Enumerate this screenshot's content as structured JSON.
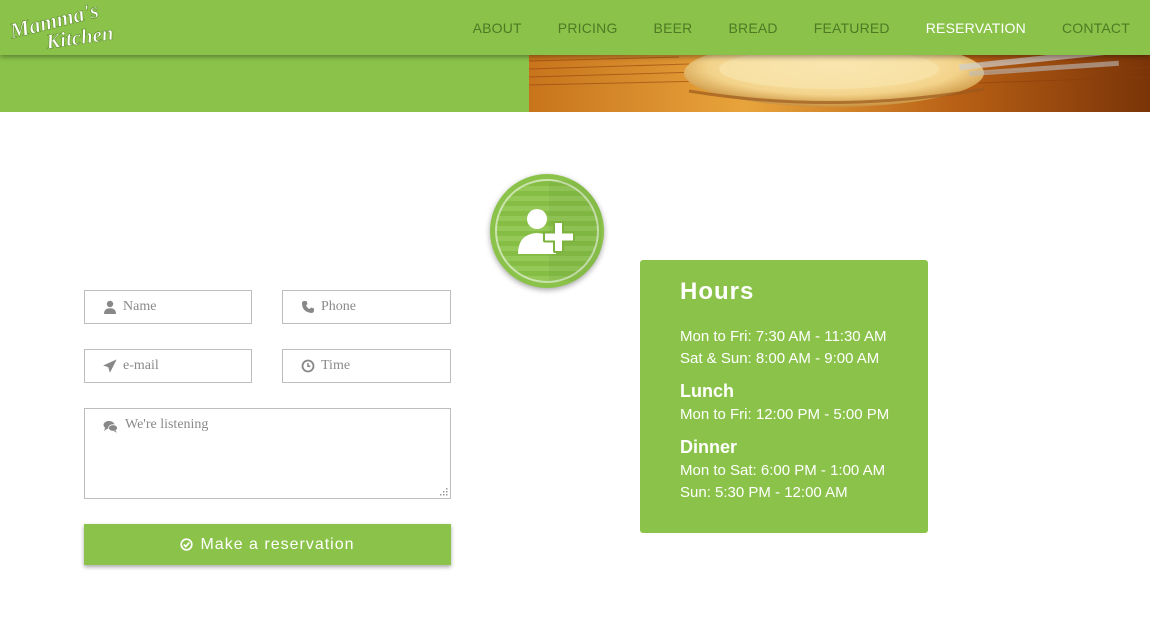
{
  "brand": {
    "logo_text_line1": "Mamma's",
    "logo_text_line2": "Kitchen"
  },
  "nav": {
    "items": [
      {
        "label": "ABOUT",
        "active": false
      },
      {
        "label": "PRICING",
        "active": false
      },
      {
        "label": "BEER",
        "active": false
      },
      {
        "label": "BREAD",
        "active": false
      },
      {
        "label": "FEATURED",
        "active": false
      },
      {
        "label": "RESERVATION",
        "active": true
      },
      {
        "label": "CONTACT",
        "active": false
      }
    ]
  },
  "badge": {
    "icon": "add-user-icon"
  },
  "form": {
    "name": {
      "placeholder": "Name",
      "value": "",
      "icon": "user-icon"
    },
    "phone": {
      "placeholder": "Phone",
      "value": "",
      "icon": "phone-icon"
    },
    "email": {
      "placeholder": "e-mail",
      "value": "",
      "icon": "paper-plane-icon"
    },
    "time": {
      "placeholder": "Time",
      "value": "",
      "icon": "clock-icon"
    },
    "message": {
      "placeholder": "We're listening",
      "value": "",
      "icon": "comments-icon"
    },
    "submit_label": "Make a reservation",
    "submit_icon": "check-circle-icon"
  },
  "hours": {
    "title": "Hours",
    "breakfast": [
      "Mon to Fri: 7:30 AM - 11:30 AM",
      "Sat & Sun: 8:00 AM - 9:00 AM"
    ],
    "lunch_title": "Lunch",
    "lunch": [
      "Mon to Fri: 12:00 PM - 5:00 PM"
    ],
    "dinner_title": "Dinner",
    "dinner": [
      "Mon to Sat: 6:00 PM - 1:00 AM",
      "Sun: 5:30 PM - 12:00 AM"
    ]
  },
  "colors": {
    "brand_green": "#8bc34a",
    "nav_text": "#4e7a24",
    "nav_active": "#ffffff"
  }
}
